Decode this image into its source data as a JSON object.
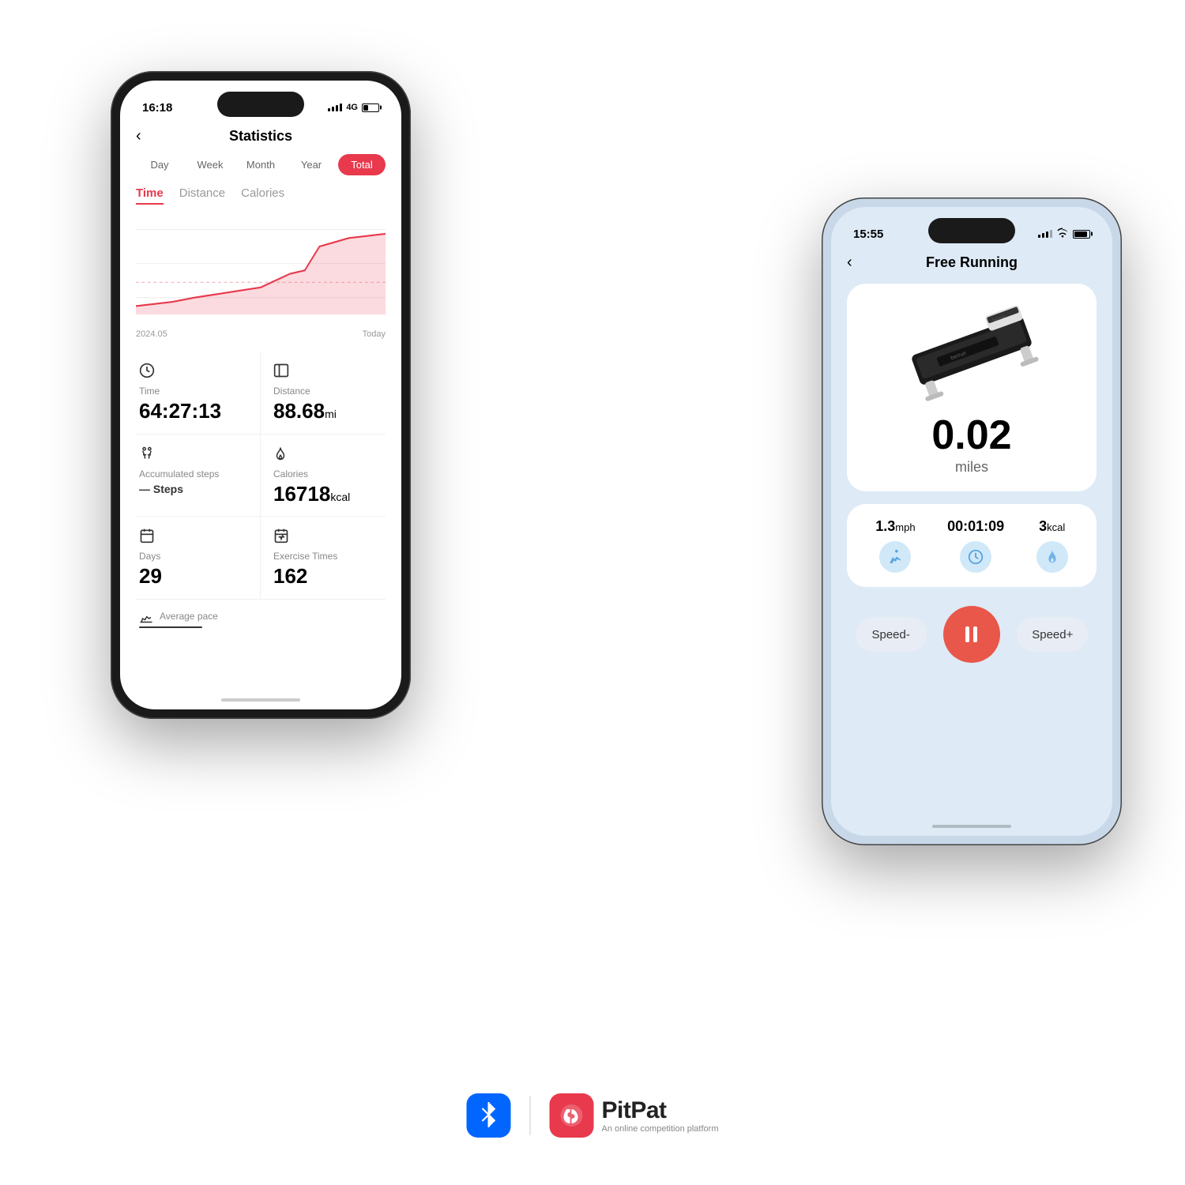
{
  "left_phone": {
    "status": {
      "time": "16:18",
      "signal": "4G",
      "battery": 32
    },
    "header": {
      "back_label": "‹",
      "title": "Statistics"
    },
    "filters": {
      "options": [
        "Day",
        "Week",
        "Month",
        "Year",
        "Total"
      ],
      "active": "Total"
    },
    "metric_tabs": {
      "tabs": [
        "Time",
        "Distance",
        "Calories"
      ],
      "active": "Time"
    },
    "chart": {
      "x_start": "2024.05",
      "x_end": "Today"
    },
    "stats": [
      {
        "icon": "clock",
        "label": "Time",
        "value": "64:27:13",
        "unit": ""
      },
      {
        "icon": "distance",
        "label": "Distance",
        "value": "88.68",
        "unit": "mi"
      },
      {
        "icon": "steps",
        "label": "Accumulated steps",
        "sub_label": "Steps",
        "value": "—",
        "unit": ""
      },
      {
        "icon": "fire",
        "label": "Calories",
        "value": "16718",
        "unit": "kcal"
      },
      {
        "icon": "calendar",
        "label": "Days",
        "value": "29",
        "unit": ""
      },
      {
        "icon": "exercise",
        "label": "Exercise Times",
        "value": "162",
        "unit": ""
      }
    ],
    "avg_pace": {
      "label": "Average pace"
    }
  },
  "right_phone": {
    "status": {
      "time": "15:55"
    },
    "header": {
      "back_label": "‹",
      "title": "Free Running"
    },
    "distance": {
      "value": "0.02",
      "unit": "miles"
    },
    "metrics": [
      {
        "value": "1.3",
        "unit": "mph",
        "icon": "run"
      },
      {
        "value": "00:01:09",
        "unit": "",
        "icon": "clock"
      },
      {
        "value": "3",
        "unit": "kcal",
        "icon": "fire"
      }
    ],
    "controls": {
      "speed_minus": "Speed-",
      "pause": "⏸",
      "speed_plus": "Speed+"
    }
  },
  "bottom": {
    "pitpat_name": "PitPat",
    "pitpat_tagline": "An online competition platform"
  }
}
